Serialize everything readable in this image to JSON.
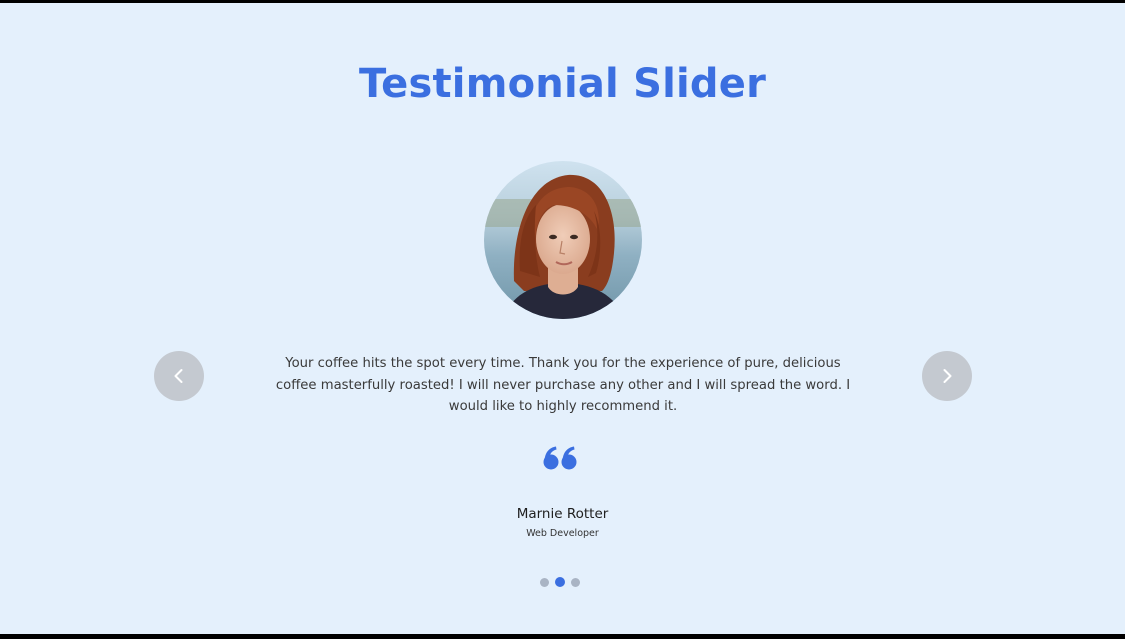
{
  "slider": {
    "title": "Testimonial Slider",
    "testimonial": {
      "text": "Your coffee hits the spot every time. Thank you for the experience of pure, delicious coffee masterfully roasted! I will never purchase any other and I will spread the word. I would like to highly recommend it.",
      "author_name": "Marnie Rotter",
      "author_role": "Web Developer"
    },
    "navigation": {
      "prev_icon": "chevron-left-icon",
      "next_icon": "chevron-right-icon"
    },
    "pagination": {
      "total": 3,
      "active_index": 1
    }
  },
  "colors": {
    "background": "#e4f0fc",
    "accent": "#3b6fe0",
    "nav_button": "#c4c9d0",
    "dot_inactive": "#a9b4c4"
  }
}
